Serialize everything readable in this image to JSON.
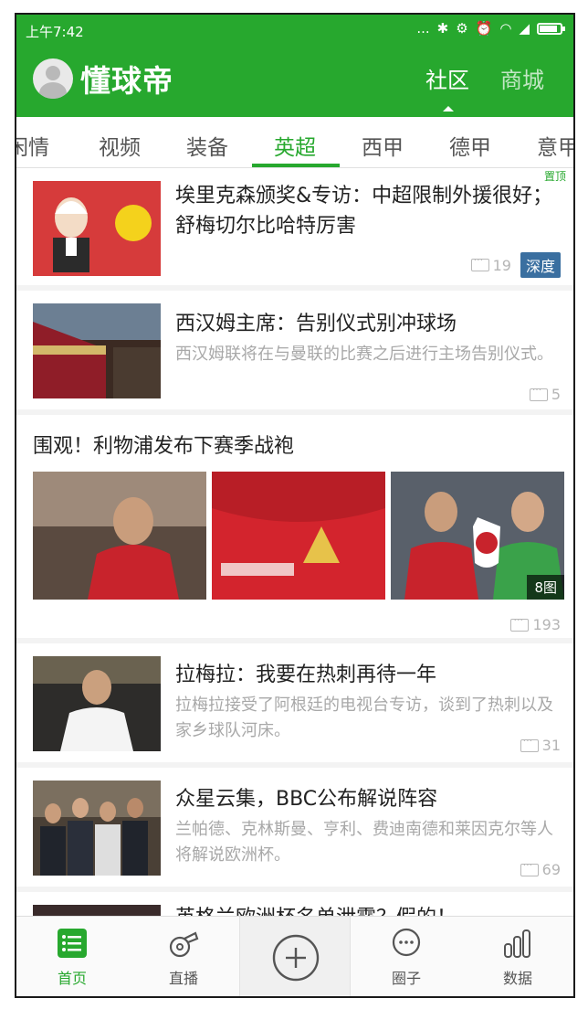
{
  "status_bar": {
    "time": "上午7:42",
    "dots": "...",
    "battery_level": 0.85
  },
  "header": {
    "logo_text": "懂球帝",
    "tabs": [
      {
        "label": "社区",
        "active": true
      },
      {
        "label": "商城",
        "active": false
      }
    ]
  },
  "categories": {
    "items": [
      "闲情",
      "视频",
      "装备",
      "英超",
      "西甲",
      "德甲",
      "意甲"
    ],
    "active": "英超"
  },
  "feed": {
    "articles": [
      {
        "title": "埃里克森颁奖&专访：中超限制外援很好；舒梅切尔比哈特厉害",
        "summary": "",
        "comments": "19",
        "tag": "深度",
        "pin_label": "置顶"
      },
      {
        "title": "西汉姆主席：告别仪式别冲球场",
        "summary": "西汉姆联将在与曼联的比赛之后进行主场告别仪式。",
        "comments": "5"
      }
    ],
    "gallery": {
      "title": "围观！利物浦发布下赛季战袍",
      "image_count": "8图",
      "comments": "193"
    },
    "articles_more": [
      {
        "title": "拉梅拉：我要在热刺再待一年",
        "summary": "拉梅拉接受了阿根廷的电视台专访，谈到了热刺以及家乡球队河床。",
        "comments": "31"
      },
      {
        "title": "众星云集，BBC公布解说阵容",
        "summary": "兰帕德、克林斯曼、亨利、费迪南德和莱因克尔等人将解说欧洲杯。",
        "comments": "69"
      },
      {
        "title": "英格兰欧洲杯名单泄露？假的！",
        "summary": "",
        "comments": ""
      }
    ]
  },
  "bottom_nav": {
    "items": [
      {
        "label": "首页",
        "icon": "list-icon",
        "active": true
      },
      {
        "label": "直播",
        "icon": "whistle-icon",
        "active": false
      },
      {
        "label": "",
        "icon": "plus-icon",
        "active": false
      },
      {
        "label": "圈子",
        "icon": "chat-bubble-icon",
        "active": false
      },
      {
        "label": "数据",
        "icon": "bar-chart-icon",
        "active": false
      }
    ]
  },
  "colors": {
    "brand_green": "#27a82e",
    "tag_blue": "#3a6fa0"
  }
}
